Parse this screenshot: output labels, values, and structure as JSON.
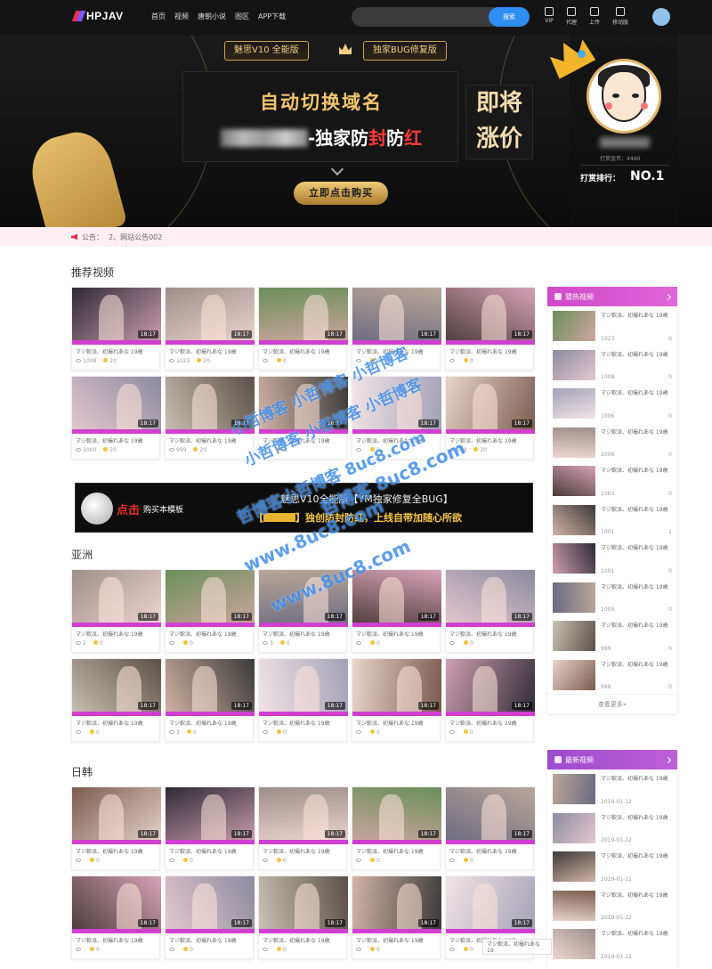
{
  "nav": {
    "logo": "HPJAV",
    "items": [
      "首页",
      "视频",
      "唐朝小说",
      "图区",
      "APP下载"
    ],
    "search_placeholder": "",
    "search_button": "搜索",
    "icons": [
      {
        "label": "VIP",
        "icon": "vip-icon"
      },
      {
        "label": "代理",
        "icon": "agent-icon"
      },
      {
        "label": "上传",
        "icon": "upload-icon"
      },
      {
        "label": "移动版",
        "icon": "mobile-icon"
      }
    ]
  },
  "banner": {
    "pill_left": "魅思V10 全能版",
    "pill_right": "独家BUG修复版",
    "line1": "自动切换域名",
    "line2_rest": "-独家防",
    "line2_red1": "封",
    "line2_mid": "防",
    "line2_red2": "红",
    "side_text": "即将涨价",
    "buy_button": "立即点击购买",
    "profile": {
      "stat": "打赏金币：4440",
      "rank_label": "打赏排行：",
      "rank_value": "NO.1"
    }
  },
  "notice": {
    "label": "公告：",
    "text": "2、网站公告002"
  },
  "sections": {
    "recommend": "推荐视频",
    "asia": "亚洲",
    "japan_korea": "日韩"
  },
  "card": {
    "title": "マジ軟派、初撮れあな 19歳",
    "duration": "18:17"
  },
  "recommend_meta": [
    [
      "1008",
      "20"
    ],
    [
      "1023",
      "20"
    ],
    [
      "",
      "0"
    ],
    [
      "",
      "0"
    ],
    [
      "",
      "0"
    ],
    [
      "1000",
      "20"
    ],
    [
      "999",
      "20"
    ],
    [
      "",
      "0"
    ],
    [
      "",
      "0"
    ],
    [
      "999",
      "20"
    ]
  ],
  "asia_meta": [
    [
      "2",
      "0"
    ],
    [
      "",
      "0"
    ],
    [
      "3",
      "0"
    ],
    [
      "",
      "0"
    ],
    [
      "",
      "0"
    ],
    [
      "",
      "0"
    ],
    [
      "3",
      "0"
    ],
    [
      "",
      "0"
    ],
    [
      "",
      "0"
    ],
    [
      "",
      "0"
    ]
  ],
  "jk_meta": [
    [
      "",
      "0"
    ],
    [
      "",
      "0"
    ],
    [
      "",
      "0"
    ],
    [
      "",
      "0"
    ],
    [
      "",
      "0"
    ],
    [
      "",
      "0"
    ],
    [
      "",
      "0"
    ],
    [
      "",
      "0"
    ],
    [
      "",
      "0"
    ],
    [
      "",
      "0"
    ]
  ],
  "ad": {
    "click": "点击",
    "buy": "购买本模板",
    "line1": "魅思V10全能版【YM独家修复全BUG】",
    "line2a": "【",
    "line2b": "】独创防封防红，",
    "line2c": "上线自带加随心所欲"
  },
  "hot": {
    "title": "猜热视频",
    "more": "查看更多»",
    "items": [
      [
        "1023",
        "0"
      ],
      [
        "1008",
        "0"
      ],
      [
        "1006",
        "0"
      ],
      [
        "1006",
        "0"
      ],
      [
        "1003",
        "0"
      ],
      [
        "1001",
        "1"
      ],
      [
        "1001",
        "0"
      ],
      [
        "1000",
        "0"
      ],
      [
        "999",
        "0"
      ],
      [
        "999",
        "0"
      ]
    ]
  },
  "latest": {
    "title": "最新视频",
    "items": [
      "2019-01-12",
      "2019-01-12",
      "2019-01-11",
      "2019-01-12",
      "2019-01-12"
    ]
  },
  "watermark": [
    "小哲博客 小哲博客 小哲博客",
    "小哲博客 小哲博客 小哲博客",
    "哲博客小哲博客 8uc8.com",
    "哲博客 8uc8.com",
    "www.8uc8.com",
    "www.8uc8.com"
  ],
  "float": {
    "text": "マジ軟派、初撮れあな 19"
  },
  "colors": {
    "accent": "#d13fd0",
    "search_button": "#2f8ef4",
    "gold": "#f2c66d",
    "nav_bg": "#141414"
  }
}
